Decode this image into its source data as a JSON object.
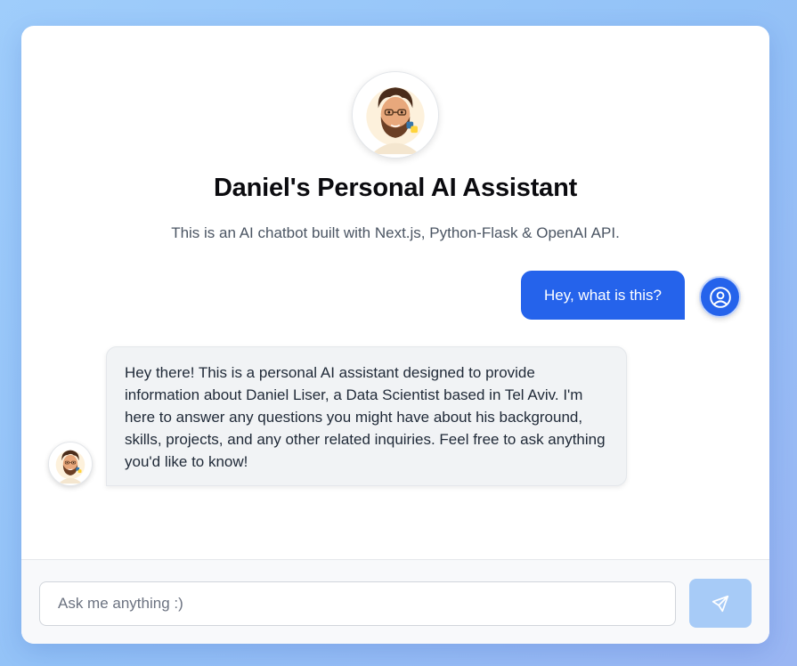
{
  "header": {
    "title": "Daniel's Personal AI Assistant",
    "subtitle": "This is an AI chatbot built with Next.js, Python-Flask & OpenAI API.",
    "avatar_icon": "memoji-avatar-icon"
  },
  "messages": [
    {
      "role": "user",
      "text": "Hey, what is this?",
      "avatar_icon": "user-circle-icon"
    },
    {
      "role": "assistant",
      "text": "Hey there! This is a personal AI assistant designed to provide information about Daniel Liser, a Data Scientist based in Tel Aviv. I'm here to answer any questions you might have about his background, skills, projects, and any other related inquiries. Feel free to ask anything you'd like to know!",
      "avatar_icon": "memoji-avatar-icon"
    }
  ],
  "composer": {
    "placeholder": "Ask me anything :)",
    "value": "",
    "send_icon": "send-icon"
  },
  "colors": {
    "accent": "#2563eb",
    "send_button_disabled": "#a7cbf7",
    "assistant_bubble": "#f1f3f5",
    "background_gradient_start": "#9fcdfb",
    "background_gradient_end": "#9ab6f3"
  }
}
